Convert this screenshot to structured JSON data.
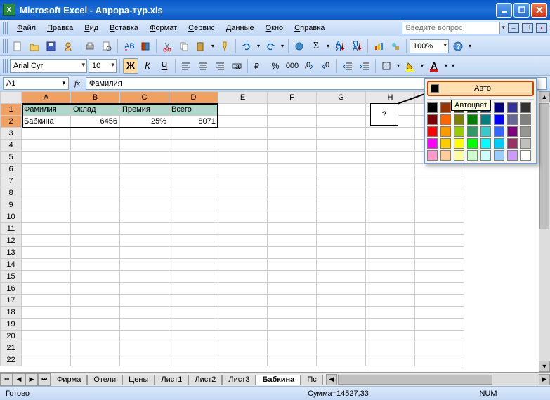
{
  "title": "Microsoft Excel - Аврора-тур.xls",
  "menus": [
    "Файл",
    "Правка",
    "Вид",
    "Вставка",
    "Формат",
    "Сервис",
    "Данные",
    "Окно",
    "Справка"
  ],
  "search_placeholder": "Введите вопрос",
  "zoom": "100%",
  "font_name": "Arial Cyr",
  "font_size": "10",
  "name_box": "A1",
  "formula": "Фамилия",
  "columns": [
    "A",
    "B",
    "C",
    "D",
    "E",
    "F",
    "G",
    "H",
    "I"
  ],
  "sel_cols": 4,
  "rows": 22,
  "sel_rows": 2,
  "data": {
    "r1": {
      "A": "Фамилия",
      "B": "Оклад",
      "C": "Премия",
      "D": "Всего"
    },
    "r2": {
      "A": "Бабкина",
      "B": "6456",
      "C": "25%",
      "D": "8071"
    }
  },
  "callout": "?",
  "color_popup": {
    "auto": "Авто",
    "tooltip": "Автоцвет",
    "colors": [
      "#000000",
      "#993300",
      "#333300",
      "#003300",
      "#003366",
      "#000080",
      "#333399",
      "#333333",
      "#800000",
      "#ff6600",
      "#808000",
      "#008000",
      "#008080",
      "#0000ff",
      "#666699",
      "#808080",
      "#ff0000",
      "#ff9900",
      "#99cc00",
      "#339966",
      "#33cccc",
      "#3366ff",
      "#800080",
      "#969696",
      "#ff00ff",
      "#ffcc00",
      "#ffff00",
      "#00ff00",
      "#00ffff",
      "#00ccff",
      "#993366",
      "#c0c0c0",
      "#ff99cc",
      "#ffcc99",
      "#ffff99",
      "#ccffcc",
      "#ccffff",
      "#99ccff",
      "#cc99ff",
      "#ffffff"
    ]
  },
  "sheets": [
    "Фирма",
    "Отели",
    "Цены",
    "Лист1",
    "Лист2",
    "Лист3",
    "Бабкина",
    "Пс"
  ],
  "active_sheet": 6,
  "status": {
    "ready": "Готово",
    "sum": "Сумма=14527,33",
    "num": "NUM"
  }
}
